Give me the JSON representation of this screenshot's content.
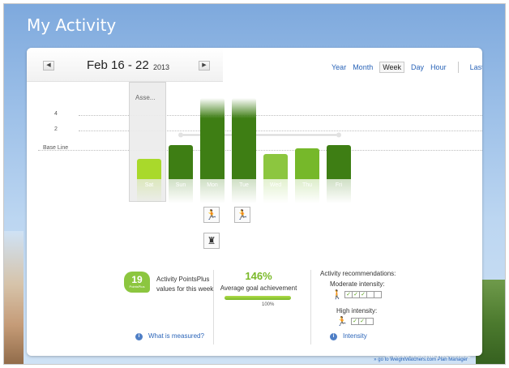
{
  "page": {
    "title": "My Activity"
  },
  "date_nav": {
    "prev_icon": "left-triangle-icon",
    "next_icon": "right-triangle-icon",
    "range_label": "Feb 16 - 22",
    "year": "2013"
  },
  "range_tabs": [
    {
      "label": "Year",
      "active": false
    },
    {
      "label": "Month",
      "active": false
    },
    {
      "label": "Week",
      "active": true
    },
    {
      "label": "Day",
      "active": false
    },
    {
      "label": "Hour",
      "active": false
    }
  ],
  "last_label": "Last",
  "chart_data": {
    "type": "bar",
    "categories": [
      "Sat",
      "Sun",
      "Mon",
      "Tue",
      "Wed",
      "Thu",
      "Fri"
    ],
    "values": [
      1.4,
      2.3,
      5.5,
      5.5,
      1.7,
      2.1,
      2.3
    ],
    "y_ticks": [
      "4",
      "2"
    ],
    "baseline_label": "Base Line",
    "average_line_value": 2.0,
    "ylim": [
      0,
      5.5
    ],
    "colors": [
      "#a9d92b",
      "#3e7e14",
      "#3e7e14",
      "#3e7e14",
      "#8cc63f",
      "#76b82a",
      "#3e7e14"
    ]
  },
  "tooltip": {
    "text": "Asse..."
  },
  "activity_icons": [
    "running-icon",
    "running-icon",
    "strength-icon"
  ],
  "stats": {
    "points_badge": {
      "value": "19",
      "sub": "PointsPlus"
    },
    "points_line1": "Activity PointsPlus",
    "points_line2": "values for this week",
    "what_measured": "What is measured?",
    "goal_pct": "146%",
    "goal_label": "Average goal achievement",
    "goal_fill": 1.0,
    "goal_mark": "100%",
    "rec_title": "Activity recommendations:",
    "moderate_label": "Moderate intensity:",
    "moderate_checks": [
      true,
      true,
      true,
      false,
      false
    ],
    "high_label": "High intensity:",
    "high_checks": [
      true,
      true,
      false
    ],
    "intensity_link": "Intensity"
  },
  "footer_link": "» go to WeightWatchers.com Plan Manager",
  "watermark": "© 2013 thiscrazylifeofmine"
}
